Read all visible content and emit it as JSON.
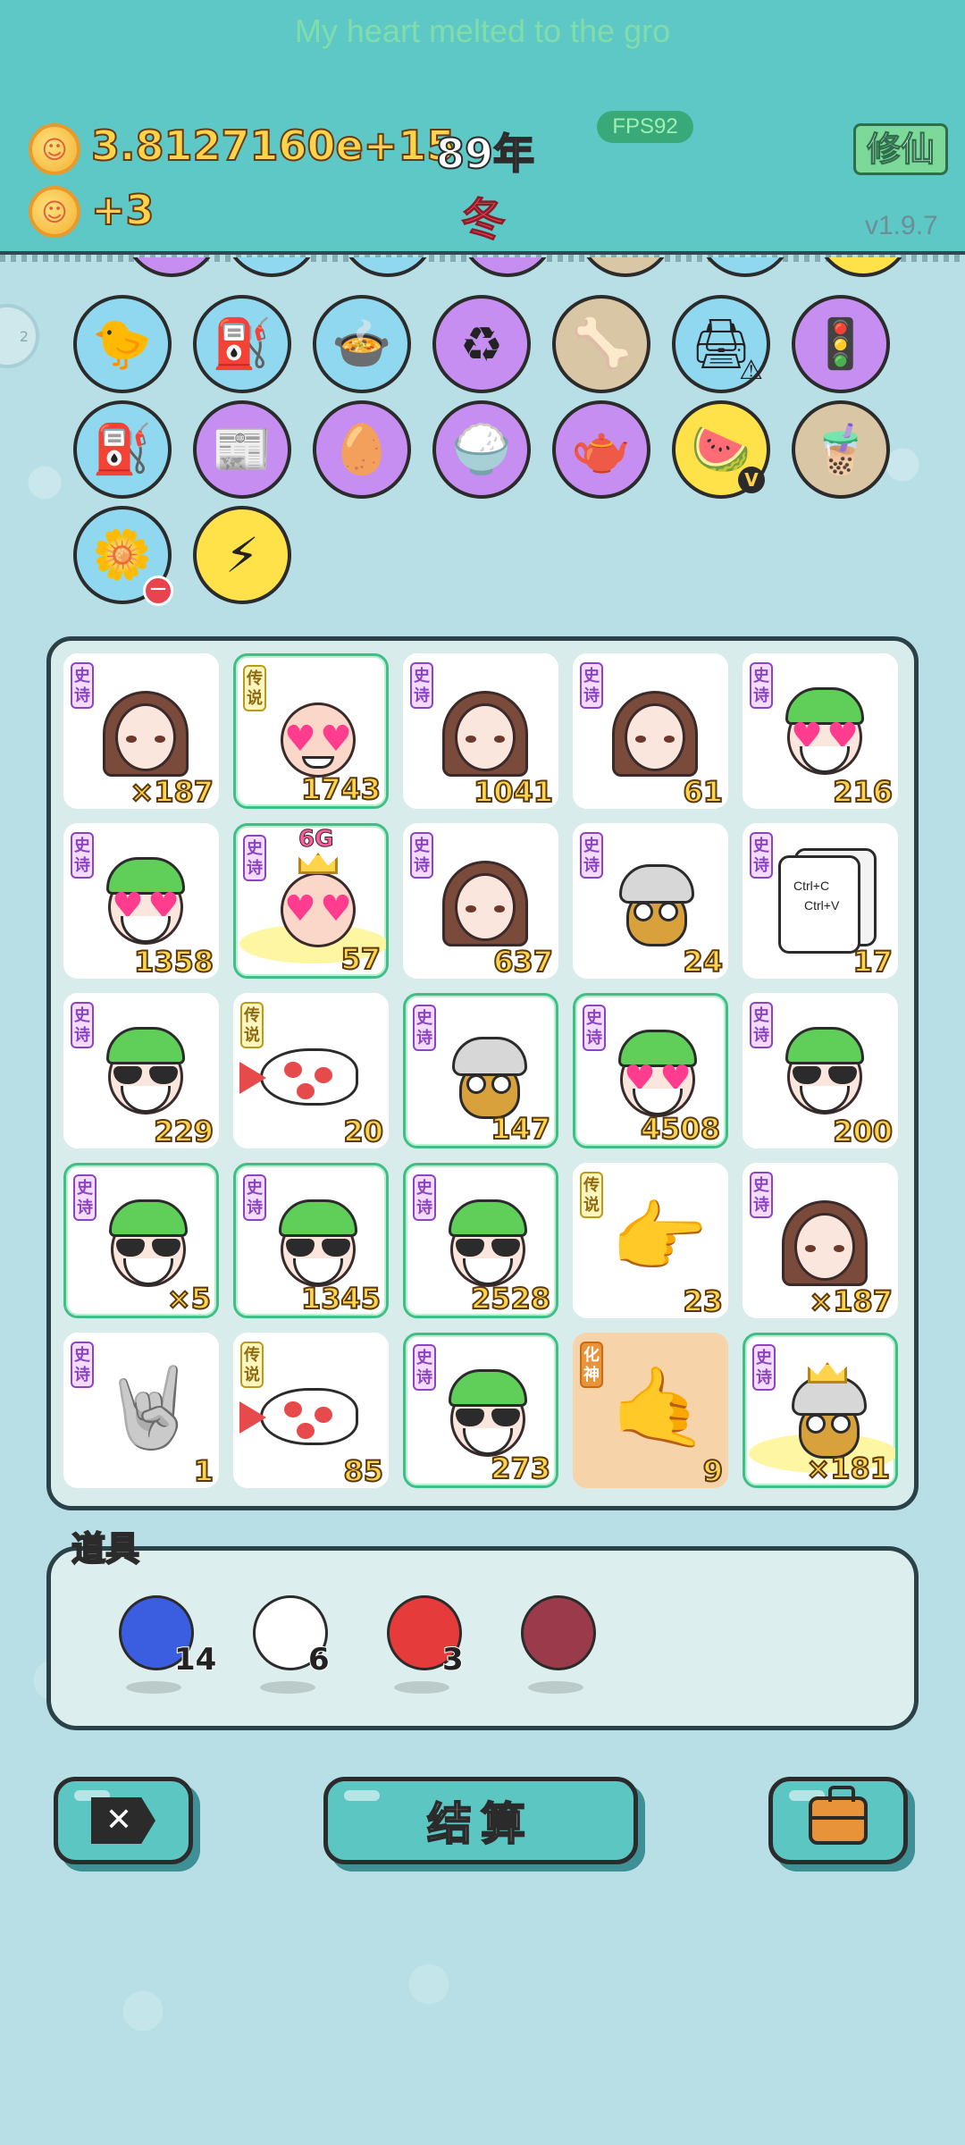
{
  "marquee": "My heart melted to the gro",
  "header": {
    "gold": "3.8127160e+15",
    "income": "+3",
    "year": "89年",
    "season": "冬",
    "fps": "FPS92",
    "mode_button": "修仙",
    "version": "v1.9.7"
  },
  "side_bubble": "2",
  "skills": [
    {
      "icon": "chick-egg",
      "color": "#8fd8ef"
    },
    {
      "icon": "bike-pump",
      "color": "#8fd8ef"
    },
    {
      "icon": "pressure-cooker-duck",
      "color": "#8fd8ef"
    },
    {
      "icon": "recycle",
      "color": "#c58ef0"
    },
    {
      "icon": "dog-bowl",
      "color": "#d9c6a4"
    },
    {
      "icon": "printer-warning",
      "color": "#8fd8ef"
    },
    {
      "icon": "traffic-light-ghost",
      "color": "#c58ef0"
    },
    {
      "icon": "bike-pump-2",
      "color": "#8fd8ef"
    },
    {
      "icon": "time-magazine",
      "color": "#c58ef0"
    },
    {
      "icon": "egg-face",
      "color": "#c58ef0"
    },
    {
      "icon": "rice-bowl",
      "color": "#c58ef0"
    },
    {
      "icon": "gravy-boat",
      "color": "#c58ef0"
    },
    {
      "icon": "fruit-basket",
      "color": "#ffe14a"
    },
    {
      "icon": "bubble-tea",
      "color": "#d9c6a4"
    },
    {
      "icon": "flower-pot",
      "color": "#8fd8ef"
    },
    {
      "icon": "lightning",
      "color": "#ffe14a"
    }
  ],
  "board": [
    [
      {
        "tag": "史诗",
        "char": "girl",
        "count": "×187",
        "glow": false
      },
      {
        "tag": "传说",
        "char": "bald-hearts",
        "count": "1743",
        "glow": true
      },
      {
        "tag": "史诗",
        "char": "girl",
        "count": "1041",
        "glow": false
      },
      {
        "tag": "史诗",
        "char": "girl",
        "count": "61",
        "glow": false
      },
      {
        "tag": "史诗",
        "char": "cap-hearts",
        "count": "216",
        "glow": false
      }
    ],
    [
      {
        "tag": "史诗",
        "char": "cap-hearts",
        "count": "1358",
        "glow": false
      },
      {
        "tag": "史诗",
        "char": "crown-6g",
        "count": "57",
        "glow": true,
        "badge": "6G"
      },
      {
        "tag": "史诗",
        "char": "girl",
        "count": "637",
        "glow": false
      },
      {
        "tag": "史诗",
        "char": "bird",
        "count": "24",
        "glow": false
      },
      {
        "tag": "史诗",
        "char": "ctrl-cv",
        "count": "17",
        "glow": false,
        "doc_text": [
          "Ctrl+C",
          "Ctrl+V"
        ]
      }
    ],
    [
      {
        "tag": "史诗",
        "char": "cap-shades",
        "count": "229",
        "glow": false
      },
      {
        "tag": "传说",
        "char": "fish",
        "count": "20",
        "glow": false
      },
      {
        "tag": "史诗",
        "char": "bird",
        "count": "147",
        "glow": true
      },
      {
        "tag": "史诗",
        "char": "cap-hearts",
        "count": "4508",
        "glow": true
      },
      {
        "tag": "史诗",
        "char": "cap-shades",
        "count": "200",
        "glow": false
      }
    ],
    [
      {
        "tag": "史诗",
        "char": "cap-shades",
        "count": "×5",
        "glow": true
      },
      {
        "tag": "史诗",
        "char": "cap-shades",
        "count": "1345",
        "glow": true
      },
      {
        "tag": "史诗",
        "char": "cap-shades",
        "count": "2528",
        "glow": true
      },
      {
        "tag": "传说",
        "char": "pointing-hand",
        "count": "23",
        "glow": false
      },
      {
        "tag": "史诗",
        "char": "girl",
        "count": "×187",
        "glow": false
      }
    ],
    [
      {
        "tag": "史诗",
        "char": "rock-hand",
        "count": "1",
        "glow": false
      },
      {
        "tag": "传说",
        "char": "fish",
        "count": "85",
        "glow": false
      },
      {
        "tag": "史诗",
        "char": "cap-shades",
        "count": "273",
        "glow": true
      },
      {
        "tag": "化神",
        "char": "rock-hand-gold",
        "count": "9",
        "glow": false,
        "orange": true
      },
      {
        "tag": "史诗",
        "char": "bird-crown",
        "count": "×181",
        "glow": true
      }
    ]
  ],
  "props": {
    "title": "道具",
    "items": [
      {
        "name": "blueberry",
        "qty": "14",
        "color": "#3b5de0"
      },
      {
        "name": "white-bird",
        "qty": "6",
        "color": "#ffffff"
      },
      {
        "name": "strawberry",
        "qty": "3",
        "color": "#e63b3b"
      },
      {
        "name": "lychee",
        "qty": "",
        "color": "#9a3a4a"
      }
    ]
  },
  "buttons": {
    "exit": "✕",
    "settle": "结算",
    "bag": "briefcase-icon"
  }
}
